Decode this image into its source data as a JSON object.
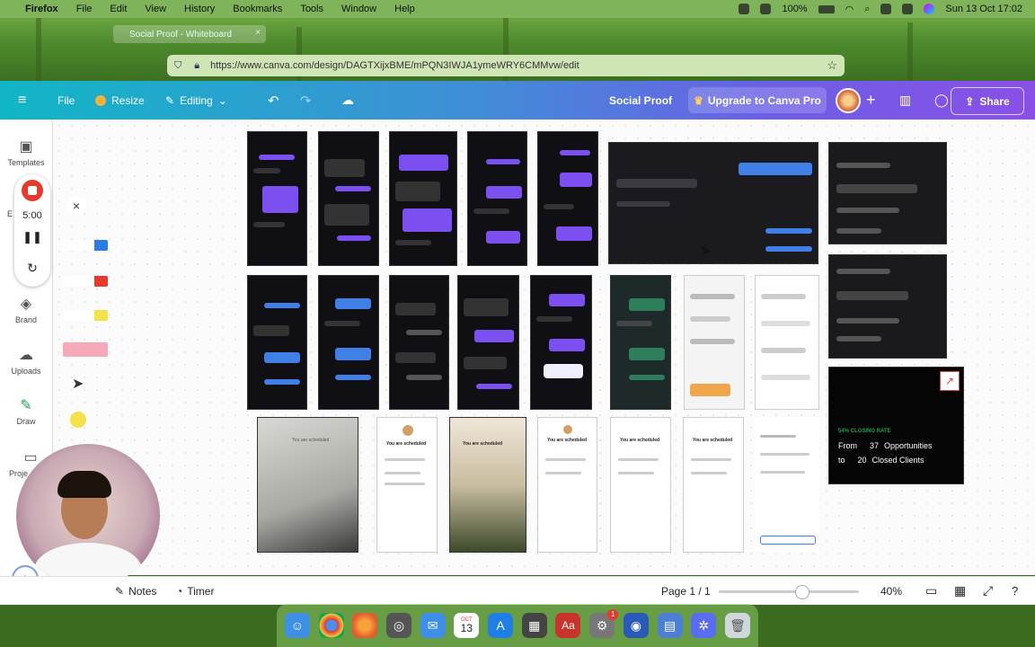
{
  "menubar": {
    "app": "Firefox",
    "items": [
      "File",
      "Edit",
      "View",
      "History",
      "Bookmarks",
      "Tools",
      "Window",
      "Help"
    ],
    "battery": "100%",
    "datetime": "Sun 13 Oct  17:02"
  },
  "browser": {
    "tab_title": "Social Proof - Whiteboard",
    "url": "https://www.canva.com/design/DAGTXijxBME/mPQN3IWJA1ymeWRY6CMMvw/edit"
  },
  "toolbar": {
    "file": "File",
    "resize": "Resize",
    "editing": "Editing",
    "doc_title": "Social Proof",
    "upgrade": "Upgrade to Canva Pro",
    "share": "Share"
  },
  "sidebar": {
    "items": [
      "Templates",
      "Brand",
      "Uploads",
      "Draw",
      "Proje"
    ],
    "partial_e": "E"
  },
  "recorder": {
    "time": "5:00"
  },
  "closing_card": {
    "label": "54% CLOSING RATE",
    "line1_a": "From",
    "line1_num": "37",
    "line1_b": "Opportunities",
    "line2_a": "to",
    "line2_num": "20",
    "line2_b": "Closed Clients"
  },
  "scheduled": {
    "heading": "You are scheduled"
  },
  "bottom": {
    "notes": "Notes",
    "timer": "Timer",
    "page": "Page 1 / 1",
    "zoom": "40%"
  },
  "dock": {
    "calendar_month": "OCT",
    "calendar_day": "13",
    "badge": "1"
  },
  "colors": {
    "toolbar_start": "#11b6c6",
    "toolbar_end": "#8a4fe6",
    "chat_purple": "#7b4ff0",
    "chat_blue": "#3f7fe6",
    "record_red": "#e53a2e"
  }
}
